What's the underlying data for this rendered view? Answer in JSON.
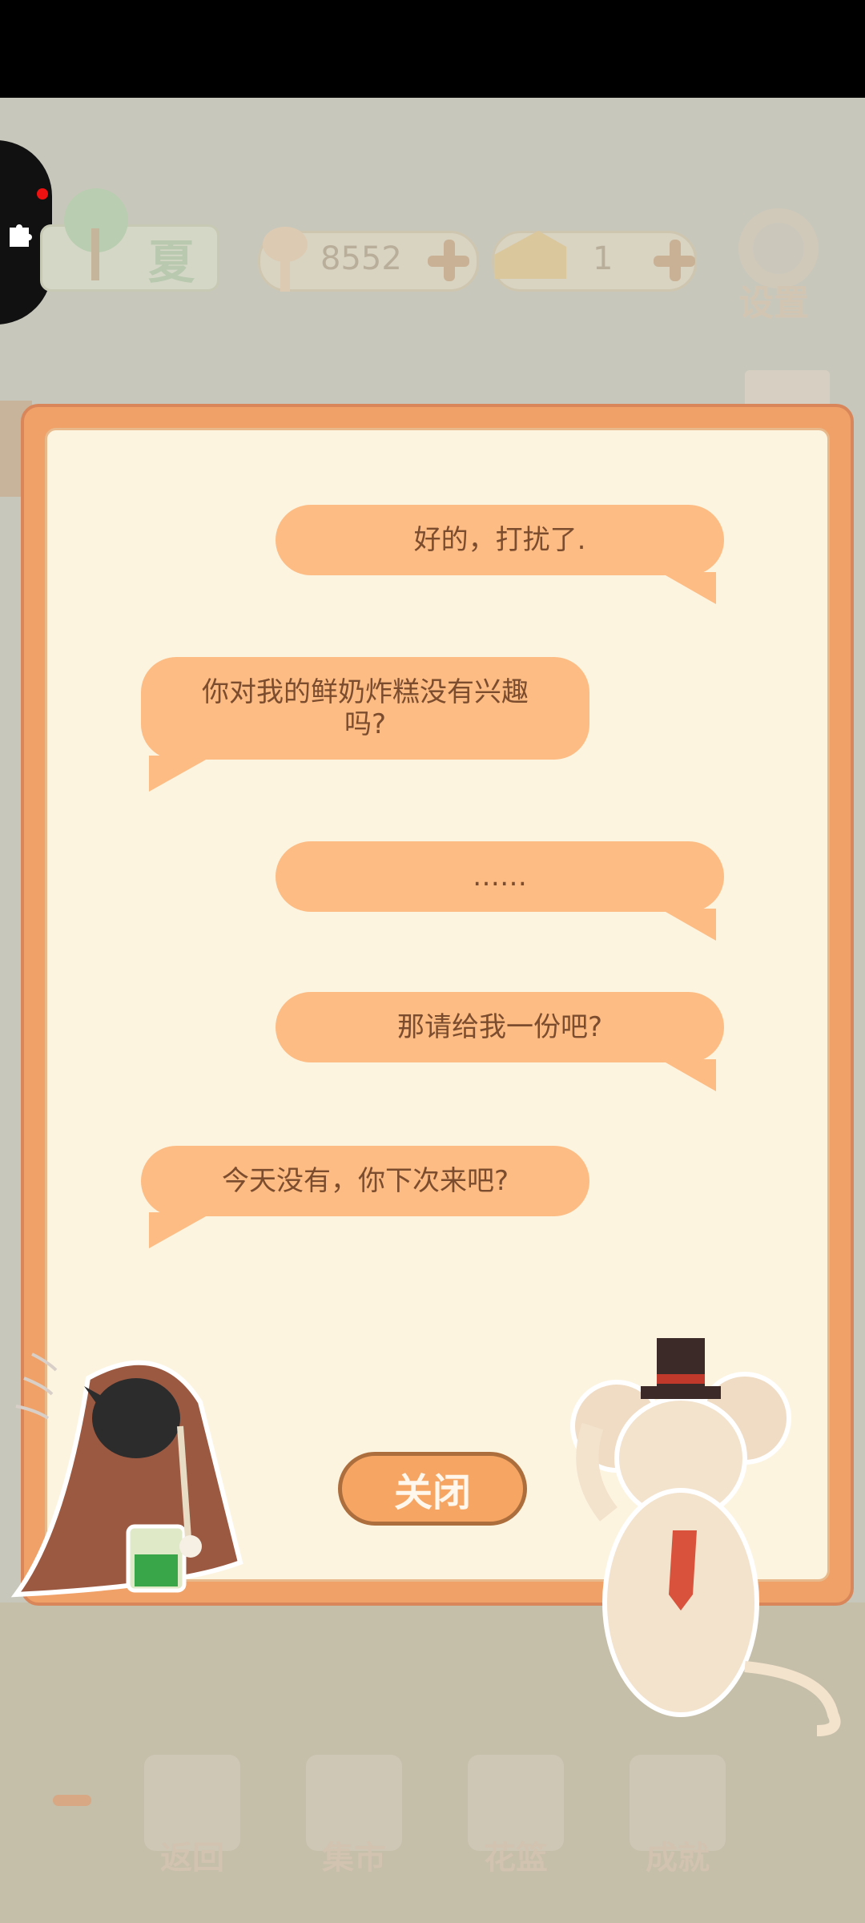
{
  "top_bar": {
    "season": "夏",
    "fish_count": "8552",
    "cheese_count": "1",
    "settings_label": "设置"
  },
  "dialog": {
    "messages": [
      {
        "side": "right",
        "text": "好的，打扰了."
      },
      {
        "side": "left",
        "text": "你对我的鲜奶炸糕没有兴趣\n吗?"
      },
      {
        "side": "right",
        "text": "……"
      },
      {
        "side": "right",
        "text": "那请给我一份吧?"
      },
      {
        "side": "left",
        "text": "今天没有，你下次来吧?"
      }
    ],
    "close_label": "关闭"
  },
  "bottom_nav": [
    {
      "label": "返回"
    },
    {
      "label": "集市"
    },
    {
      "label": "花篮"
    },
    {
      "label": "成就"
    }
  ]
}
